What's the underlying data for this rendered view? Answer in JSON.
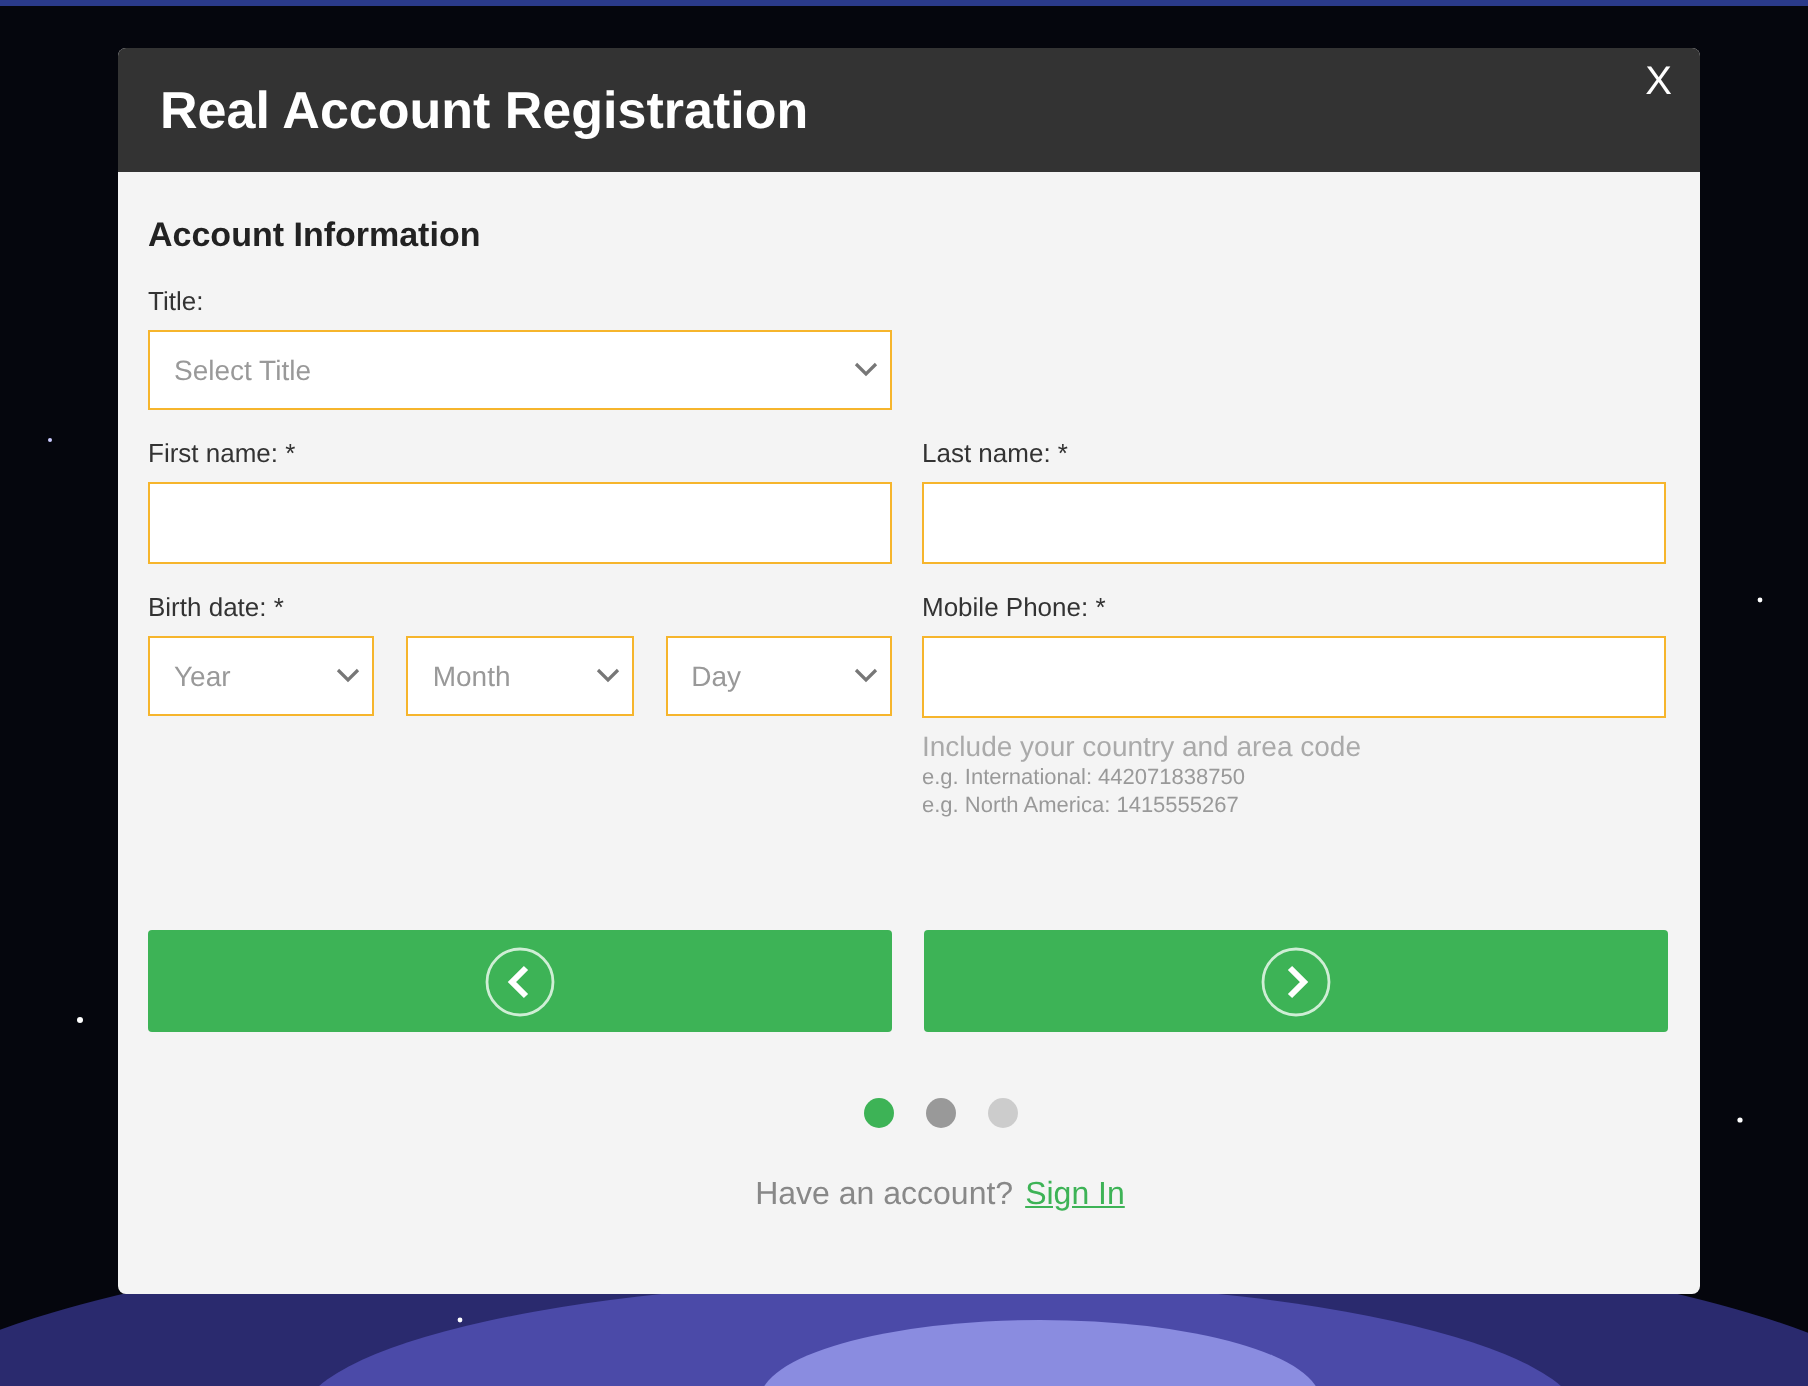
{
  "dialog": {
    "title": "Real Account Registration",
    "close": "X"
  },
  "section_title": "Account Information",
  "title_field": {
    "label": "Title:",
    "placeholder": "Select Title"
  },
  "first_name": {
    "label": "First name: *"
  },
  "last_name": {
    "label": "Last name: *"
  },
  "birth_date": {
    "label": "Birth date: *",
    "selects": [
      {
        "placeholder": "Year"
      },
      {
        "placeholder": "Month"
      },
      {
        "placeholder": "Day"
      }
    ]
  },
  "mobile_phone": {
    "label": "Mobile Phone: *",
    "hint": "Include your country and area code",
    "examples": [
      "e.g. International: 442071838750",
      "e.g. North America: 1415555267"
    ]
  },
  "steps": [
    {
      "kind": "current"
    },
    {
      "kind": "done"
    },
    {
      "kind": "pending"
    }
  ],
  "footer": {
    "text": "Have an account?",
    "link": "Sign In"
  }
}
